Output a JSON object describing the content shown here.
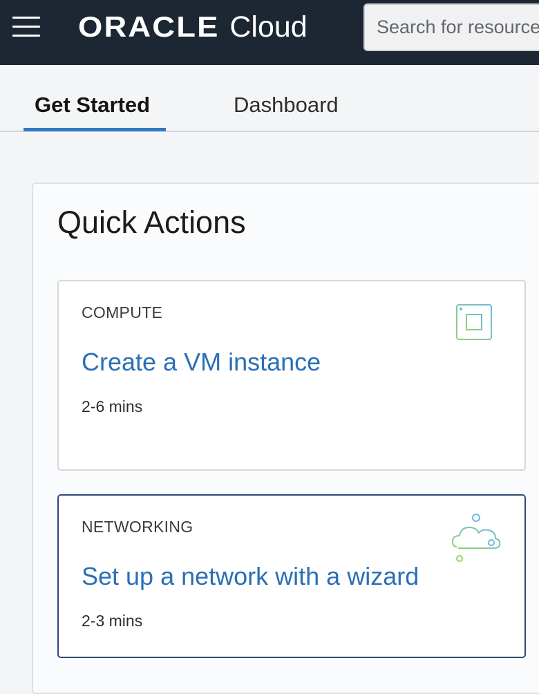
{
  "header": {
    "brand": "ORACLE",
    "product": "Cloud",
    "search_placeholder": "Search for resources"
  },
  "tabs": [
    {
      "label": "Get Started",
      "active": true
    },
    {
      "label": "Dashboard",
      "active": false
    }
  ],
  "quick_actions": {
    "title": "Quick Actions",
    "cards": [
      {
        "category": "COMPUTE",
        "title": "Create a VM instance",
        "duration": "2-6 mins",
        "icon": "chip-icon"
      },
      {
        "category": "NETWORKING",
        "title": "Set up a network with a wizard",
        "duration": "2-3 mins",
        "icon": "cloud-network-icon"
      }
    ]
  },
  "colors": {
    "header_bg": "#1c2733",
    "accent": "#2c7ac5",
    "link": "#2a6fb6",
    "icon_gradient_start": "#5fd39a",
    "icon_gradient_end": "#7db7e6"
  }
}
